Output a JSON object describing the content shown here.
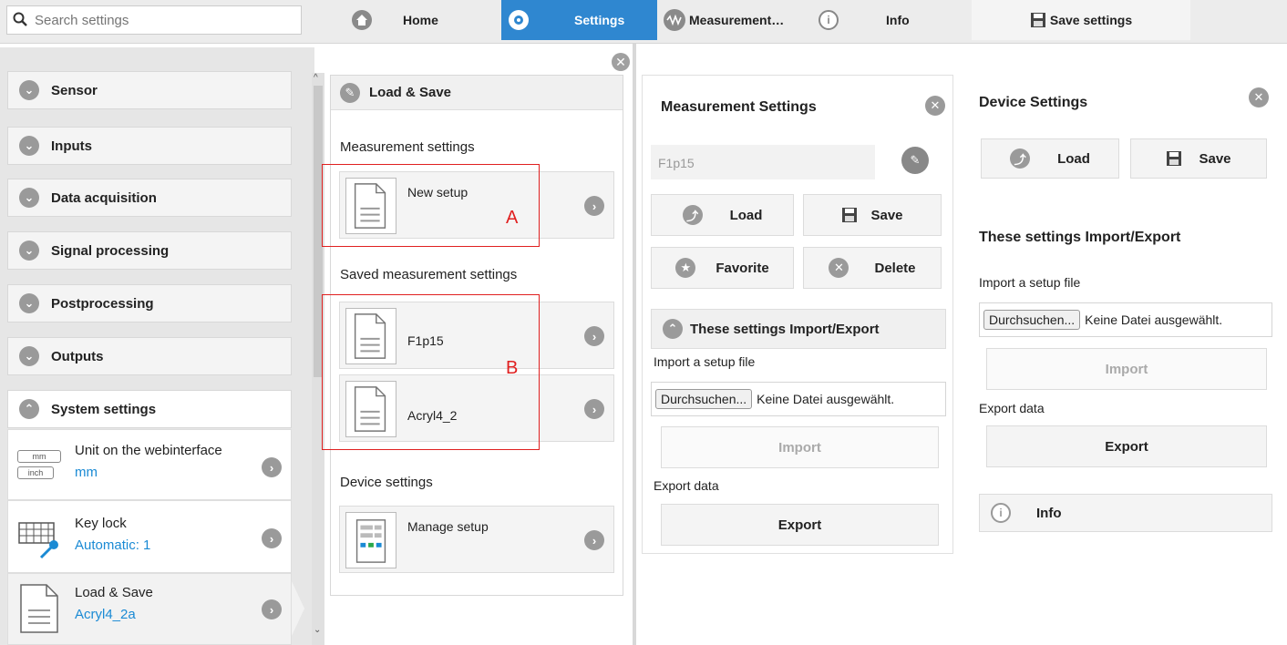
{
  "search": {
    "placeholder": "Search settings"
  },
  "nav": {
    "home": "Home",
    "settings": "Settings",
    "measurement": "Measurement…",
    "info": "Info",
    "save": "Save settings"
  },
  "colors": {
    "accent": "#2f87d0",
    "link": "#1a8ad4",
    "annotation": "#e02020"
  },
  "sidebar": {
    "categories": [
      "Sensor",
      "Inputs",
      "Data acquisition",
      "Signal processing",
      "Postprocessing",
      "Outputs",
      "System settings"
    ],
    "items": [
      {
        "label": "Unit on the webinterface",
        "value": "mm",
        "icon_top": "mm",
        "icon_bottom": "inch"
      },
      {
        "label": "Key lock",
        "value": "Automatic: 1"
      },
      {
        "label": "Load & Save",
        "value": "Acryl4_2a"
      }
    ]
  },
  "loadsave": {
    "title": "Load & Save",
    "section_measurement": "Measurement settings",
    "new_setup": "New setup",
    "section_saved": "Saved measurement settings",
    "saved": [
      "F1p15",
      "Acryl4_2"
    ],
    "section_device": "Device settings",
    "manage_setup": "Manage setup",
    "annotation_a": "A",
    "annotation_b": "B"
  },
  "measurement_panel": {
    "title": "Measurement Settings",
    "name_value": "F1p15",
    "load": "Load",
    "save": "Save",
    "favorite": "Favorite",
    "delete": "Delete",
    "io_title": "These settings Import/Export",
    "import_label": "Import a setup file",
    "browse": "Durchsuchen...",
    "no_file": "Keine Datei ausgewählt.",
    "import_btn": "Import",
    "export_label": "Export data",
    "export_btn": "Export"
  },
  "device_panel": {
    "title": "Device Settings",
    "load": "Load",
    "save": "Save",
    "io_title": "These settings Import/Export",
    "import_label": "Import a setup file",
    "browse": "Durchsuchen...",
    "no_file": "Keine Datei ausgewählt.",
    "import_btn": "Import",
    "export_label": "Export data",
    "export_btn": "Export",
    "info": "Info"
  }
}
